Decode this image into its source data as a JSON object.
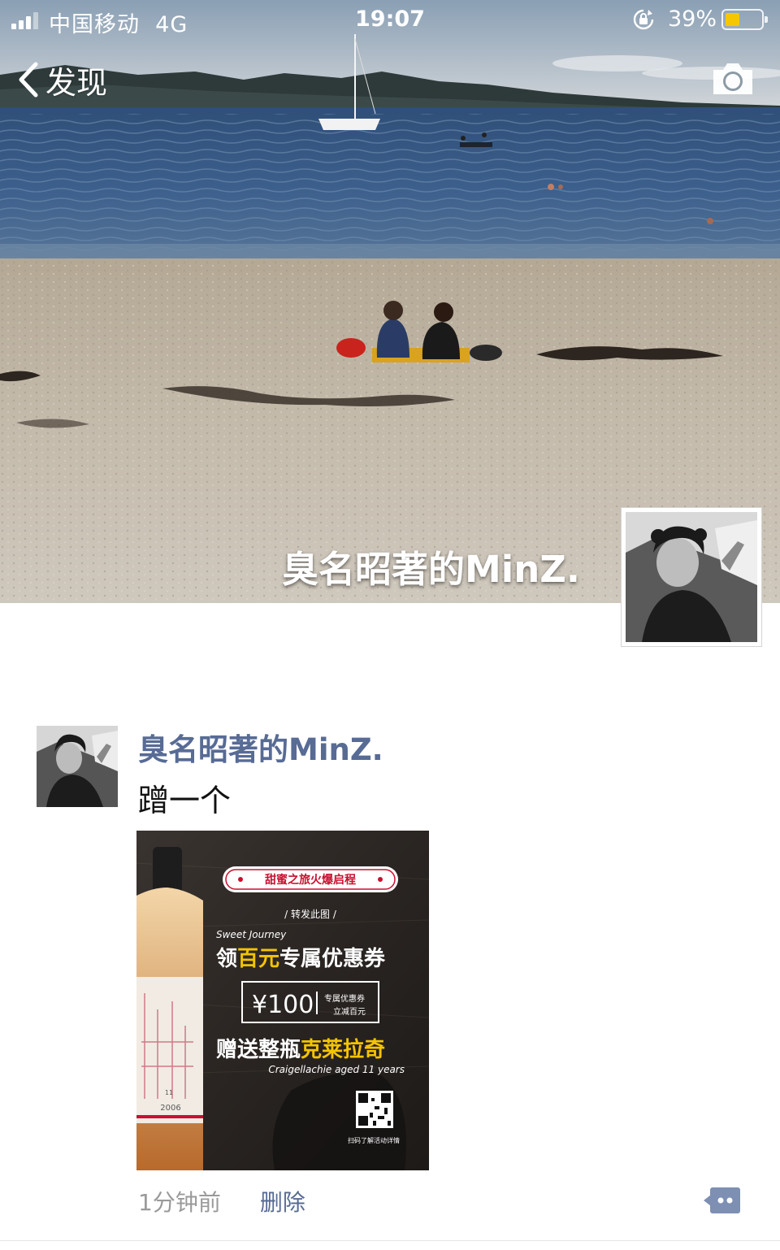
{
  "status_bar": {
    "carrier": "中国移动",
    "network": "4G",
    "time": "19:07",
    "battery_percent": "39%",
    "battery_level": 0.39
  },
  "nav": {
    "back_label": "发现",
    "back_icon": "chevron-left-icon",
    "camera_icon": "camera-icon"
  },
  "profile": {
    "name": "臭名昭著的MinZ."
  },
  "post": {
    "author": "臭名昭著的MinZ.",
    "text": "蹭一个",
    "image": {
      "banner": "甜蜜之旅火爆启程",
      "forward": "/ 转发此图 /",
      "script_line": "Sweet Journey",
      "headline_pre": "领",
      "headline_highlight": "百元",
      "headline_post": "专属优惠券",
      "coupon_value": "¥100",
      "coupon_line1": "专属优惠券",
      "coupon_line2": "立减百元",
      "gift_pre": "赠送整瓶",
      "gift_highlight": "克莱拉奇",
      "gift_script": "Craigellachie aged 11 years",
      "qr_caption": "扫码了解活动详情",
      "bottle_age": "11",
      "bottle_year": "2006"
    },
    "time": "1分钟前",
    "delete_label": "删除"
  },
  "colors": {
    "link_blue": "#576b95",
    "ad_red": "#c8102e",
    "ad_yellow": "#f5c400"
  }
}
